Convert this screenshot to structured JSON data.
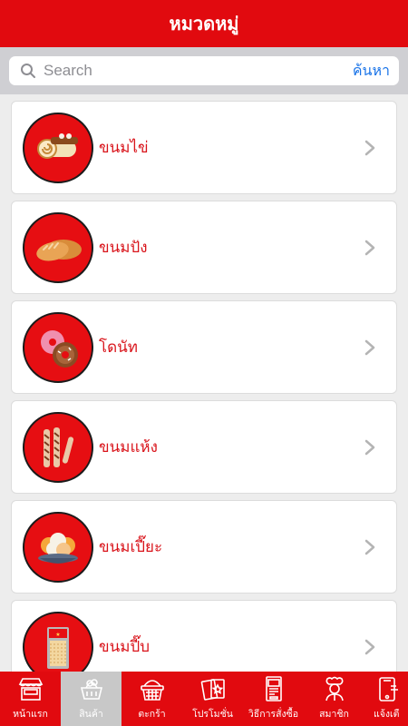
{
  "header": {
    "title": "หมวดหมู่"
  },
  "search": {
    "placeholder": "Search",
    "button_label": "ค้นหา"
  },
  "categories": [
    {
      "label": "ขนมไข่",
      "icon": "roll-cake-icon"
    },
    {
      "label": "ขนมปัง",
      "icon": "bread-icon"
    },
    {
      "label": "โดนัท",
      "icon": "donut-icon"
    },
    {
      "label": "ขนมแห้ง",
      "icon": "wafer-stick-icon"
    },
    {
      "label": "ขนมเปี๊ยะ",
      "icon": "pastry-bowl-icon"
    },
    {
      "label": "ขนมปี๊บ",
      "icon": "biscuit-tin-icon"
    }
  ],
  "tabbar": {
    "items": [
      {
        "label": "หน้าแรก",
        "icon": "bakery-shop-icon"
      },
      {
        "label": "สินค้า",
        "icon": "basket-icon",
        "active": true
      },
      {
        "label": "ตะกร้า",
        "icon": "cart-basket-icon"
      },
      {
        "label": "โปรโมชั่น",
        "icon": "promo-cards-icon"
      },
      {
        "label": "วิธีการสั่งซื้อ",
        "icon": "order-machine-icon"
      },
      {
        "label": "สมาชิก",
        "icon": "chef-icon"
      },
      {
        "label": "แจ้งเตื",
        "icon": "phone-notify-icon"
      }
    ]
  },
  "colors": {
    "brand_red": "#e10a0f",
    "label_red": "#d9141b",
    "search_blue": "#1a74e8"
  }
}
